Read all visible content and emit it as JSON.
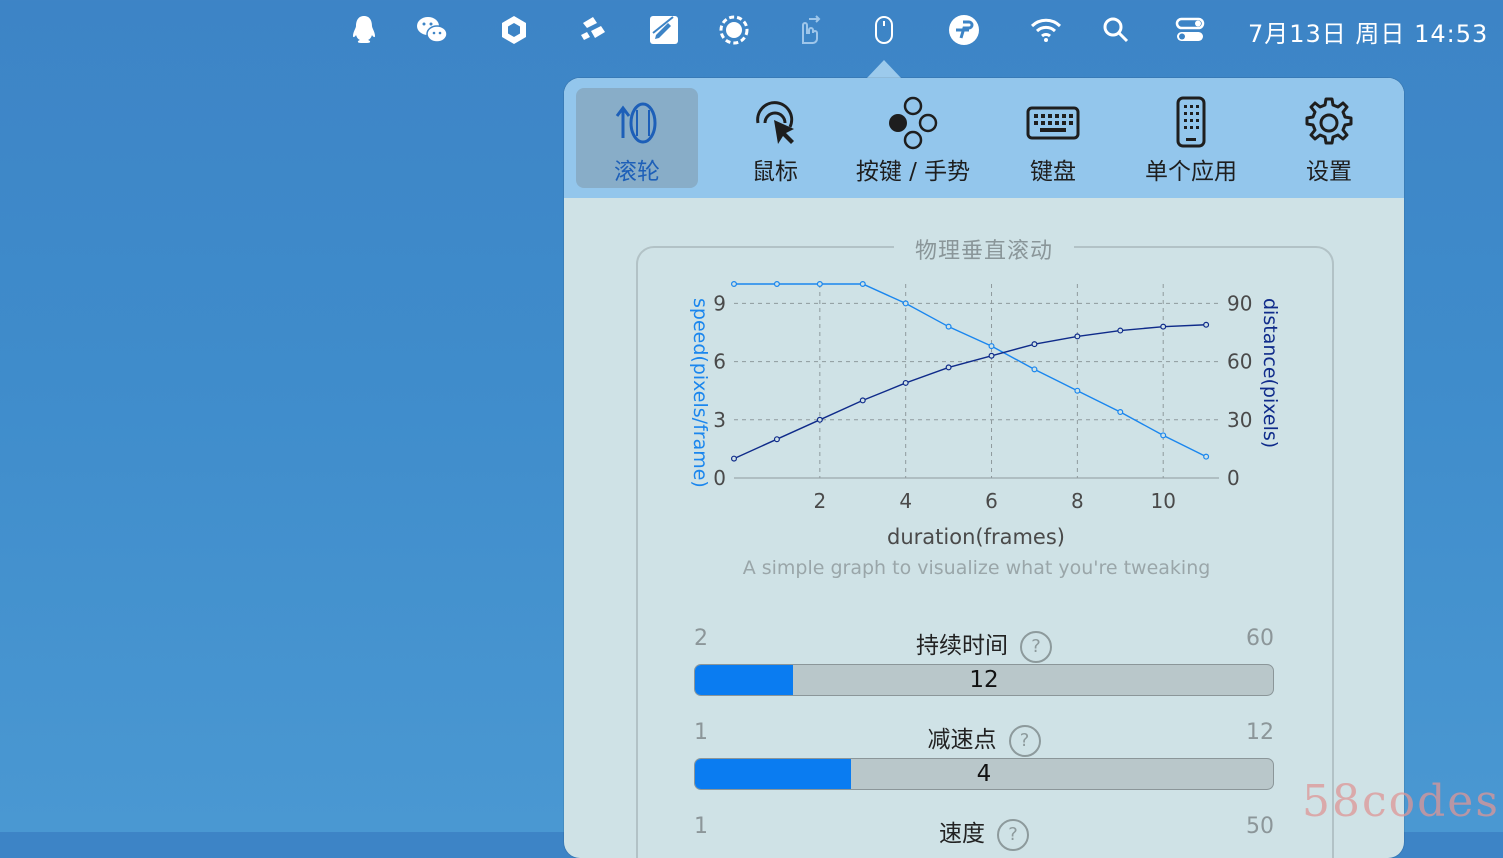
{
  "menubar": {
    "icons": [
      "qq-icon",
      "wechat-icon",
      "hexagon-app-icon",
      "bolt-app-icon",
      "pencil-app-icon",
      "record-app-icon",
      "touch-hand-icon",
      "mouse-icon",
      "pin-app-icon",
      "wifi-icon",
      "search-icon",
      "control-center-icon"
    ],
    "clock": "7月13日 周日  14:53"
  },
  "tabs": [
    {
      "label": "滚轮",
      "icon": "scroll-wheel-icon",
      "active": true
    },
    {
      "label": "鼠标",
      "icon": "cursor-click-icon",
      "active": false
    },
    {
      "label": "按键 / 手势",
      "icon": "buttons-gesture-icon",
      "active": false
    },
    {
      "label": "键盘",
      "icon": "keyboard-icon",
      "active": false
    },
    {
      "label": "单个应用",
      "icon": "phone-app-icon",
      "active": false
    },
    {
      "label": "设置",
      "icon": "gear-icon",
      "active": false
    }
  ],
  "section_title": "物理垂直滚动",
  "chart_data": {
    "type": "line",
    "xlabel": "duration(frames)",
    "ylabel_left": "speed(pixels/frame)",
    "ylabel_right": "distance(pixels)",
    "x_ticks": [
      2,
      4,
      6,
      8,
      10
    ],
    "left_ticks": [
      0,
      3,
      6,
      9
    ],
    "right_ticks": [
      0,
      30,
      60,
      90
    ],
    "xlim": [
      0,
      11.3
    ],
    "ylim_left": [
      0,
      10
    ],
    "ylim_right": [
      0,
      100
    ],
    "grid": true,
    "series": [
      {
        "name": "speed(pixels/frame)",
        "axis": "left",
        "color": "#1a86ee",
        "x": [
          0,
          1,
          2,
          3,
          4,
          5,
          6,
          7,
          8,
          9,
          10,
          11
        ],
        "y": [
          10,
          10,
          10,
          10,
          9,
          7.8,
          6.8,
          5.6,
          4.5,
          3.4,
          2.2,
          1.1
        ]
      },
      {
        "name": "distance(pixels)",
        "axis": "right",
        "color": "#0f2b8a",
        "x": [
          0,
          1,
          2,
          3,
          4,
          5,
          6,
          7,
          8,
          9,
          10,
          11
        ],
        "y": [
          10,
          20,
          30,
          40,
          49,
          57,
          63,
          69,
          73,
          76,
          78,
          79
        ]
      }
    ]
  },
  "chart_caption": "A simple graph to visualize what you're tweaking",
  "sliders": [
    {
      "label": "持续时间",
      "min": "2",
      "max": "60",
      "value": "12",
      "fill_fraction": 0.17
    },
    {
      "label": "减速点",
      "min": "1",
      "max": "12",
      "value": "4",
      "fill_fraction": 0.27
    },
    {
      "label": "速度",
      "min": "1",
      "max": "50",
      "value": "",
      "fill_fraction": 0
    }
  ],
  "help_glyph": "?",
  "watermark": "58codes",
  "colors": {
    "accent": "#0a7cf1",
    "tabbar": "#93c6ec",
    "panel": "#cfe2e6"
  }
}
